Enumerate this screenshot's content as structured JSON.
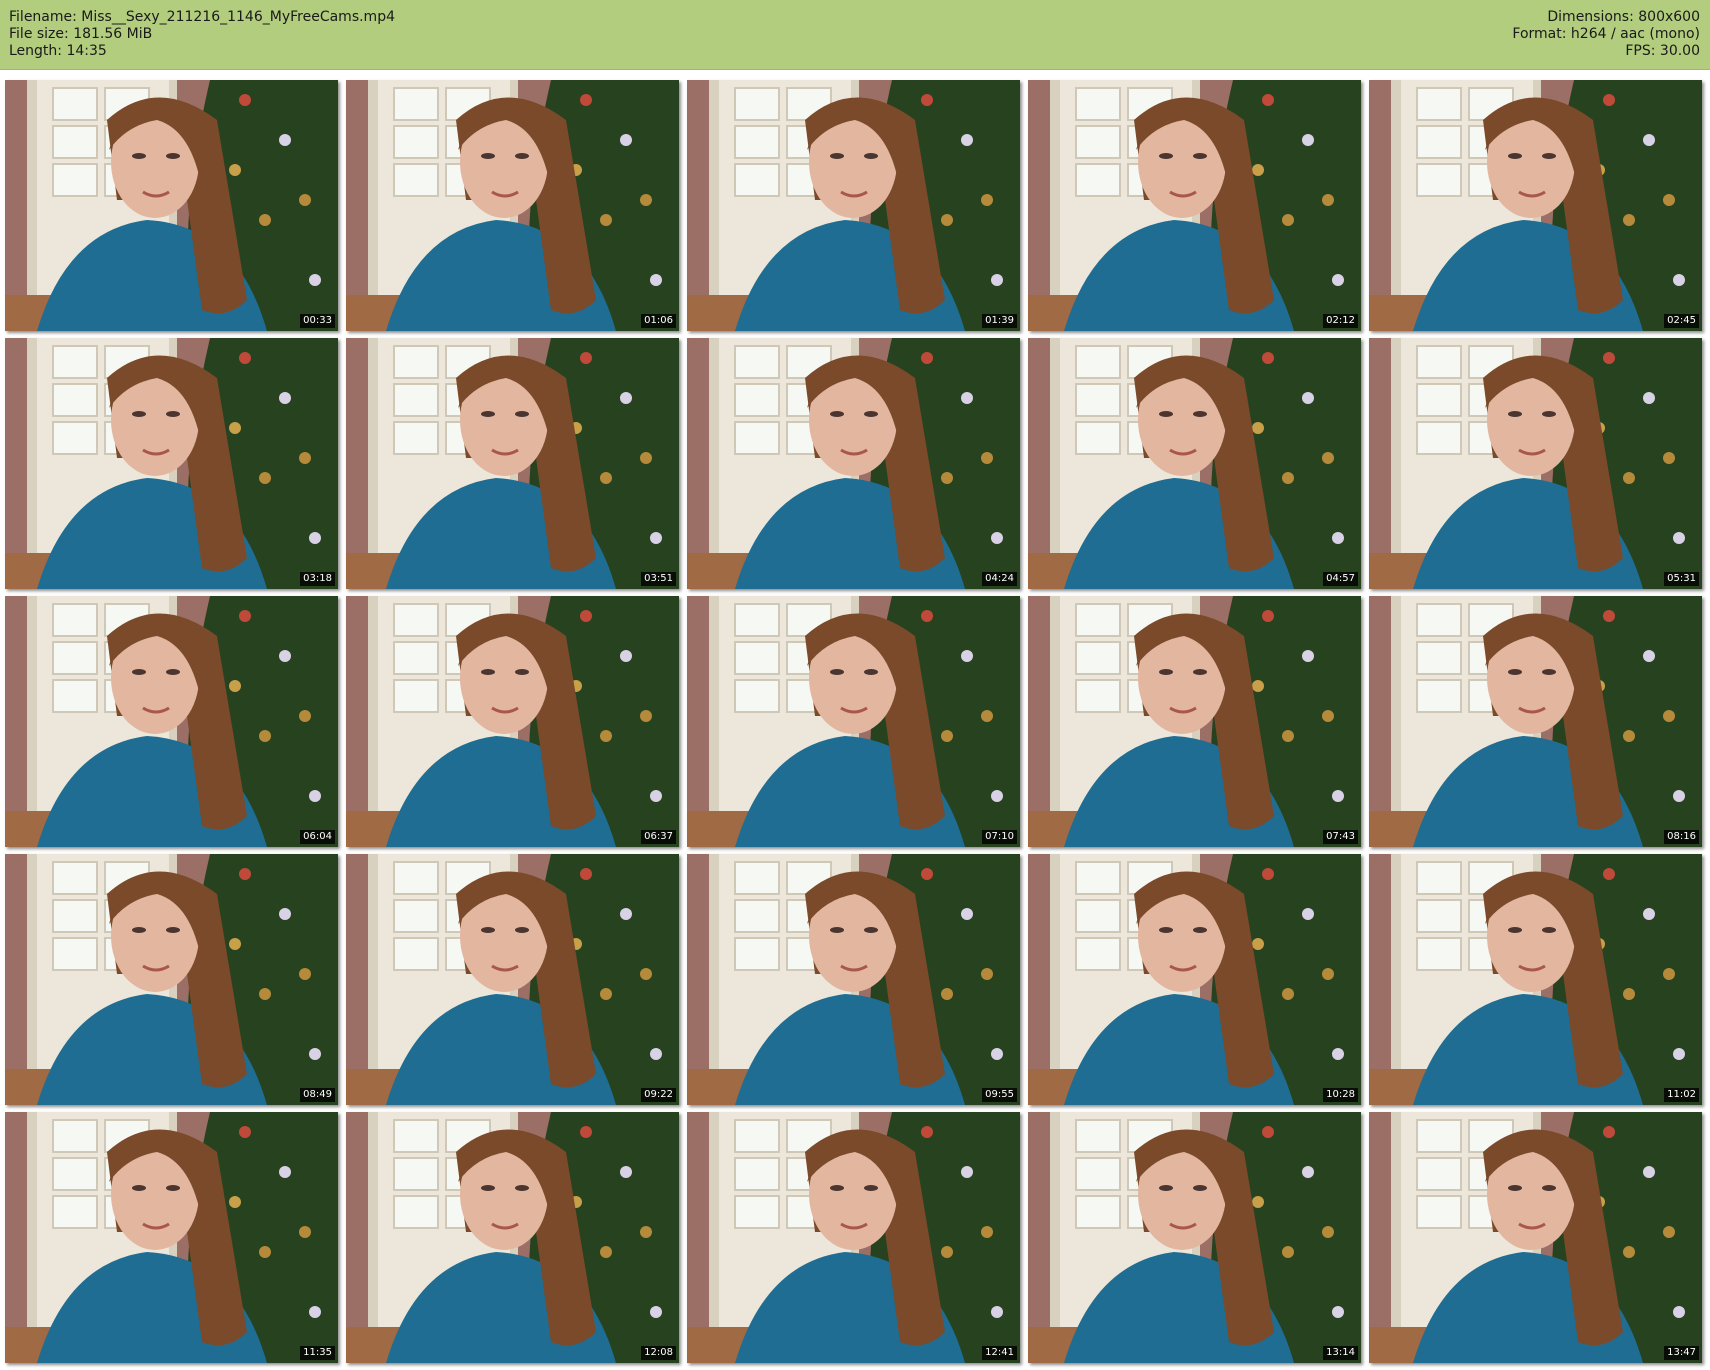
{
  "info": {
    "filename": "Filename: Miss__Sexy_211216_1146_MyFreeCams.mp4",
    "filesize": "File size: 181.56 MiB",
    "length": "Length: 14:35",
    "dimensions": "Dimensions: 800x600",
    "format": "Format: h264 / aac (mono)",
    "fps": "FPS: 30.00"
  },
  "colors": {
    "header_bg": "#b2cd7e",
    "wall": "#9c6f66",
    "door": "#ece7da",
    "window_glass": "#f6f8f4",
    "tree": "#26421f",
    "sweater": "#1f6d92",
    "hair": "#7a4a2a",
    "skin": "#e3b6a0"
  },
  "timestamps": [
    "00:33",
    "01:06",
    "01:39",
    "02:12",
    "02:45",
    "03:18",
    "03:51",
    "04:24",
    "04:57",
    "05:31",
    "06:04",
    "06:37",
    "07:10",
    "07:43",
    "08:16",
    "08:49",
    "09:22",
    "09:55",
    "10:28",
    "11:02",
    "11:35",
    "12:08",
    "12:41",
    "13:14",
    "13:47"
  ]
}
